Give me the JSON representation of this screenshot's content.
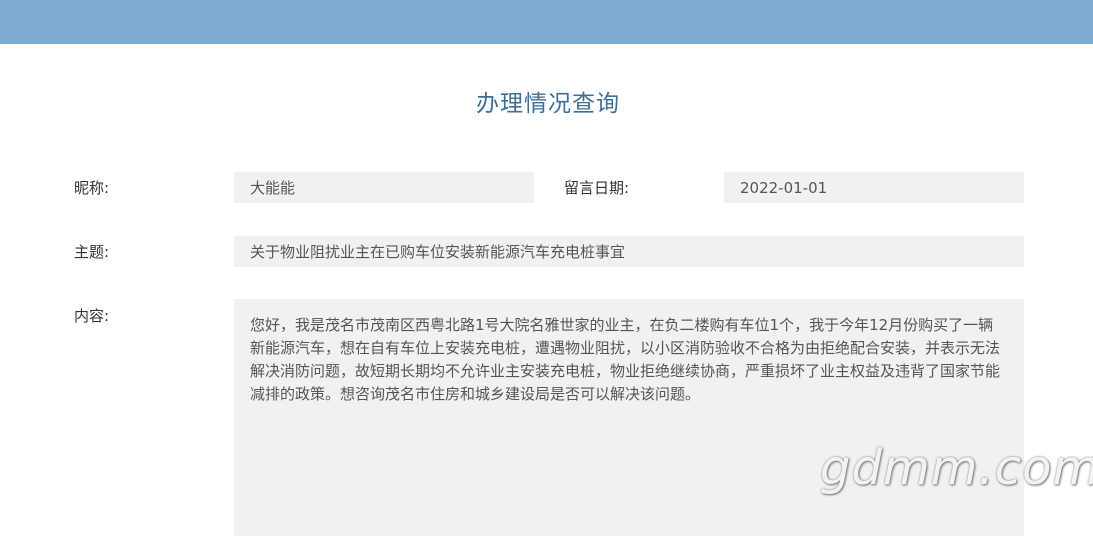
{
  "page": {
    "title": "办理情况查询"
  },
  "form": {
    "nickname_label": "昵称:",
    "nickname_value": "大能能",
    "date_label": "留言日期:",
    "date_value": "2022-01-01",
    "subject_label": "主题:",
    "subject_value": "关于物业阻扰业主在已购车位安装新能源汽车充电桩事宜",
    "content_label": "内容:",
    "content_value": "您好，我是茂名市茂南区西粤北路1号大院名雅世家的业主，在负二楼购有车位1个，我于今年12月份购买了一辆新能源汽车，想在自有车位上安装充电桩，遭遇物业阻扰，以小区消防验收不合格为由拒绝配合安装，并表示无法解决消防问题，故短期长期均不允许业主安装充电桩，物业拒绝继续协商，严重损坏了业主权益及违背了国家节能减排的政策。想咨询茂名市住房和城乡建设局是否可以解决该问题。"
  },
  "watermark": {
    "text": "gdmm.com"
  },
  "colors": {
    "top_bar": "#7fabd0",
    "title": "#3d6f99",
    "field_bg": "#f1f1f1"
  }
}
